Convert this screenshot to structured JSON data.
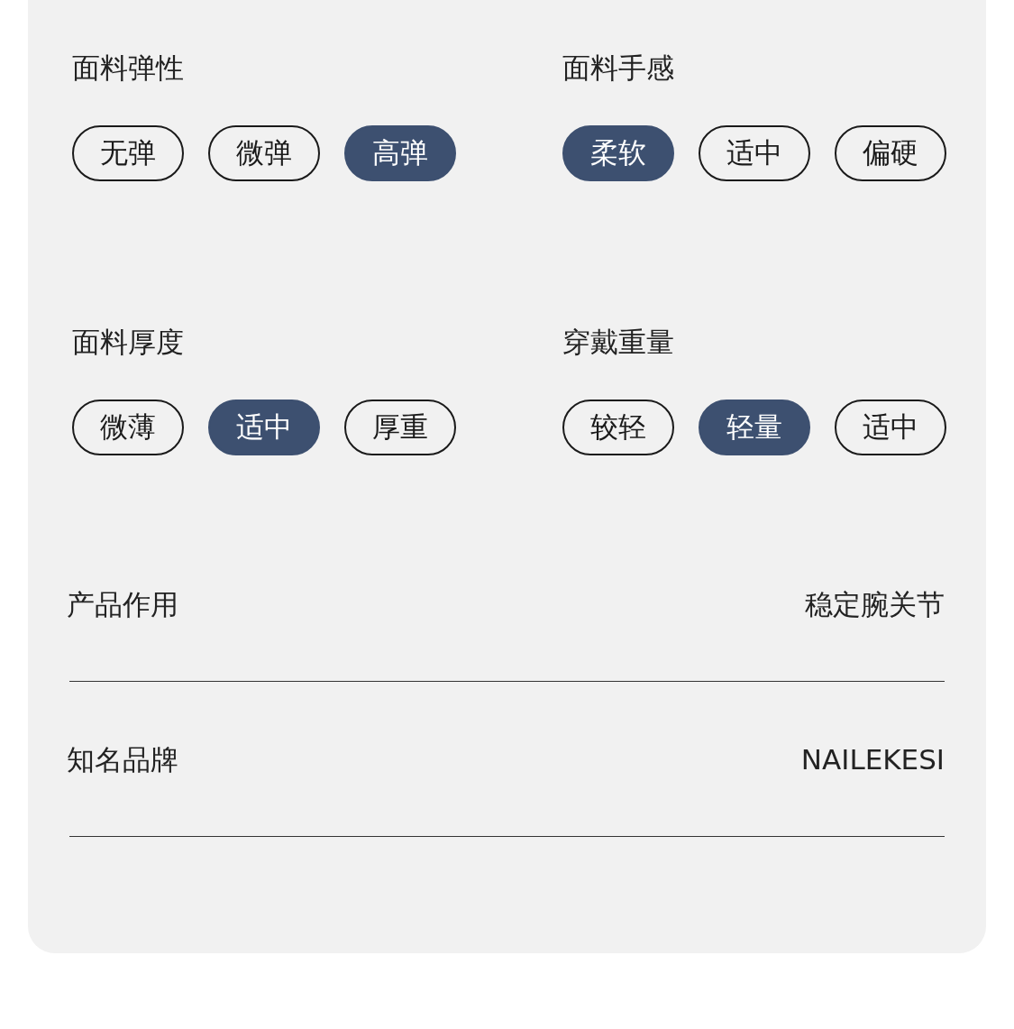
{
  "attribute_groups": [
    {
      "title": "面料弹性",
      "options": [
        {
          "label": "无弹",
          "selected": false
        },
        {
          "label": "微弹",
          "selected": false
        },
        {
          "label": "高弹",
          "selected": true
        }
      ]
    },
    {
      "title": "面料手感",
      "options": [
        {
          "label": "柔软",
          "selected": true
        },
        {
          "label": "适中",
          "selected": false
        },
        {
          "label": "偏硬",
          "selected": false
        }
      ]
    },
    {
      "title": "面料厚度",
      "options": [
        {
          "label": "微薄",
          "selected": false
        },
        {
          "label": "适中",
          "selected": true
        },
        {
          "label": "厚重",
          "selected": false
        }
      ]
    },
    {
      "title": "穿戴重量",
      "options": [
        {
          "label": "较轻",
          "selected": false
        },
        {
          "label": "轻量",
          "selected": true
        },
        {
          "label": "适中",
          "selected": false
        }
      ]
    }
  ],
  "spec_rows": [
    {
      "label": "产品作用",
      "value": "稳定腕关节"
    },
    {
      "label": "知名品牌",
      "value": "NAILEKESI"
    }
  ]
}
